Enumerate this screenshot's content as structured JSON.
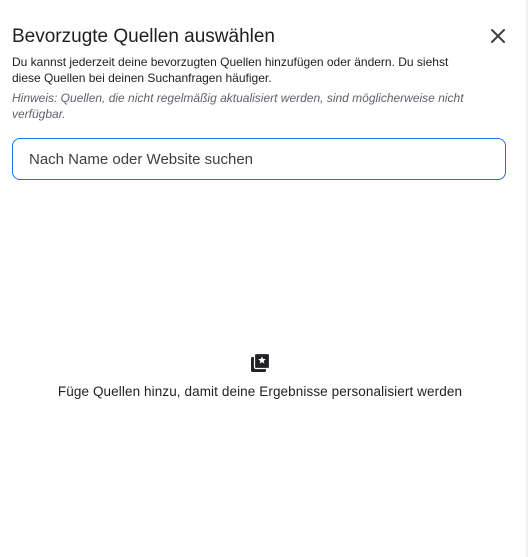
{
  "dialog": {
    "title": "Bevorzugte Quellen auswählen",
    "close_icon": "close-icon",
    "description": "Du kannst jederzeit deine bevorzugten Quellen hinzufügen oder ändern. Du siehst diese Quellen bei deinen Suchanfragen häufiger.",
    "hint": "Hinweis: Quellen, die nicht regelmäßig aktualisiert werden, sind möglicherweise nicht verfügbar."
  },
  "search": {
    "value": "",
    "placeholder": "Nach Name oder Website suchen"
  },
  "empty_state": {
    "icon": "starred-library-icon",
    "message": "Füge Quellen hinzu, damit deine Ergebnisse personalisiert werden"
  },
  "colors": {
    "accent": "#1a73e8",
    "text": "#202124",
    "hint": "#5f6368"
  }
}
